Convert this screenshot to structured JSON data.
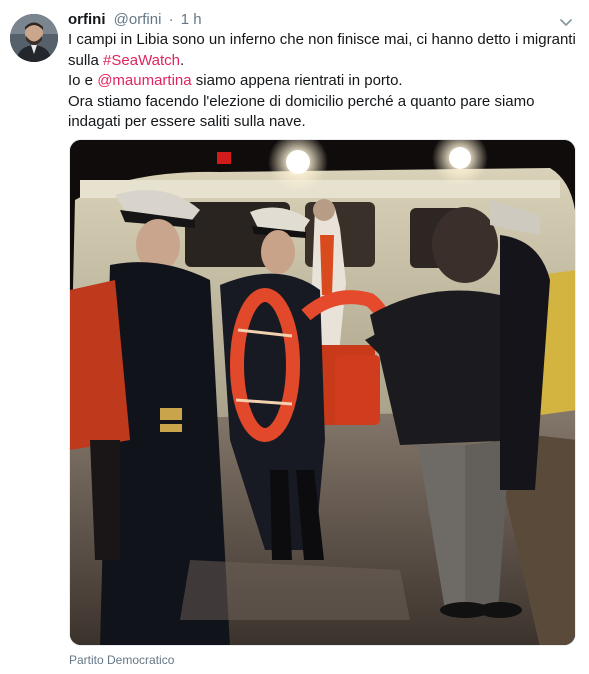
{
  "author": {
    "name": "orfini",
    "handle": "@orfini",
    "separator": "·",
    "time": "1 h",
    "avatar_icon": "person-avatar"
  },
  "tweet": {
    "line1_before": "I campi in Libia sono un inferno che non finisce mai, ci hanno detto i migranti sulla ",
    "hashtag": "#SeaWatch",
    "line1_after": ".",
    "line2_before": "Io e ",
    "mention": "@maumartina",
    "line2_after": " siamo appena rientrati in porto.",
    "line3": "Ora stiamo facendo l'elezione di domicilio perché a quanto pare siamo indagati per essere saliti sulla nave."
  },
  "media": {
    "icon": "photo"
  },
  "source_label": "Partito Democratico",
  "colors": {
    "link": "#e0245e",
    "secondary_text": "#657786",
    "primary_text": "#14171a"
  }
}
